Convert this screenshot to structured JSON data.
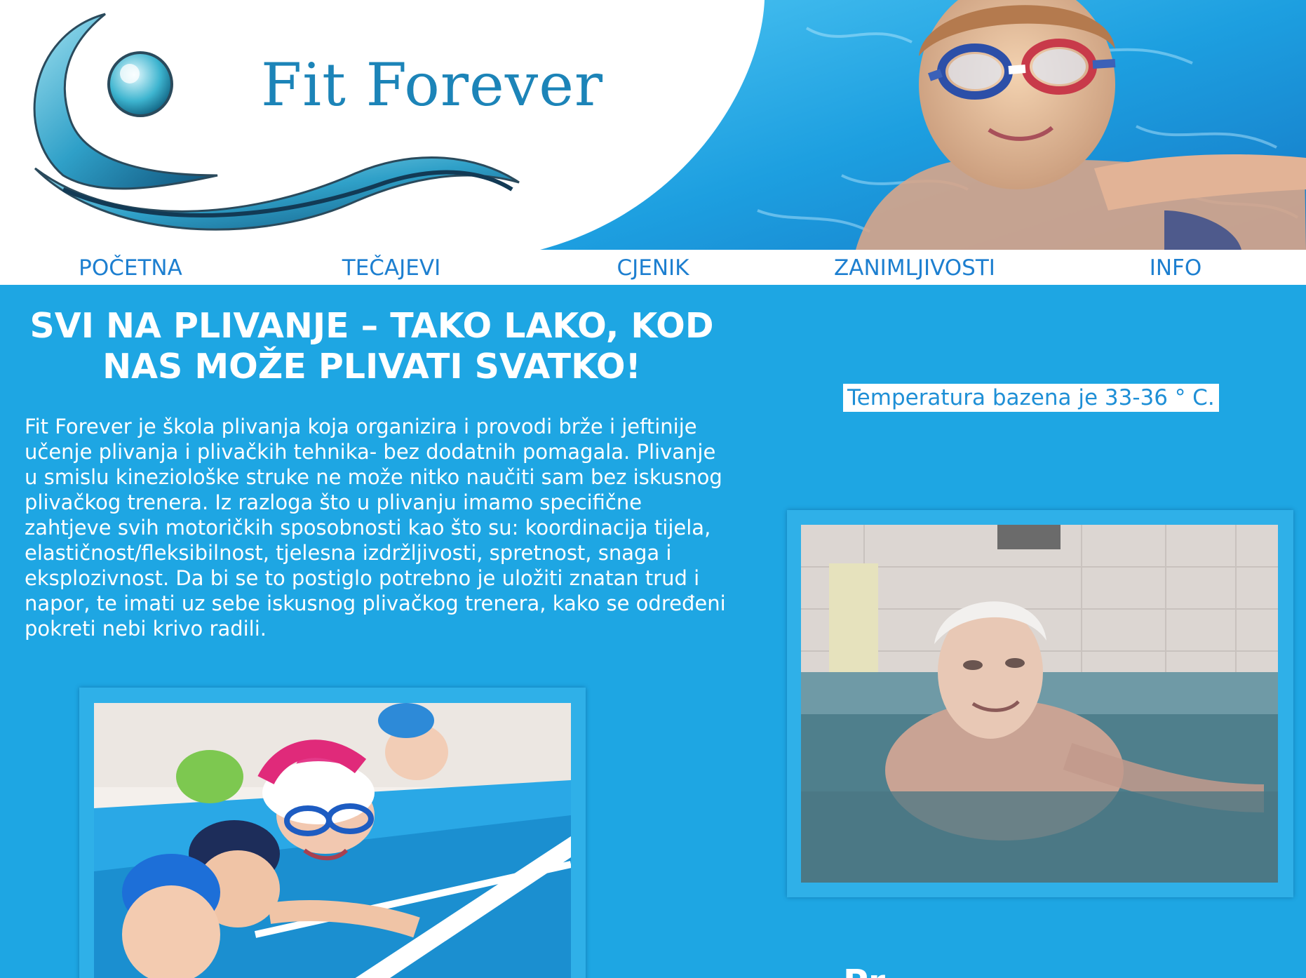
{
  "header": {
    "brand": "Fit Forever"
  },
  "nav": {
    "items": [
      {
        "label": "POČETNA"
      },
      {
        "label": "TEČAJEVI"
      },
      {
        "label": "CJENIK"
      },
      {
        "label": "ZANIMLJIVOSTI"
      },
      {
        "label": "INFO"
      }
    ]
  },
  "main": {
    "headline": "SVI NA PLIVANJE – TAKO LAKO, KOD NAS MOŽE PLIVATI SVATKO!",
    "intro": "Fit Forever je škola plivanja koja organizira i provodi brže i jeftinije učenje plivanja i plivačkih tehnika- bez dodatnih pomagala. Plivanje u smislu kineziološke struke ne može nitko naučiti sam bez iskusnog plivačkog trenera. Iz razloga što u plivanju imamo specifične zahtjeve svih motoričkih sposobnosti kao što su: koordinacija tijela, elastičnost/fleksibilnost, tjelesna izdržljivosti, spretnost, snaga i eksplozivnost. Da bi se to postiglo potrebno je uložiti znatan trud i napor, te imati uz sebe iskusnog plivačkog trenera, kako se određeni pokreti nebi krivo radili."
  },
  "sidebar": {
    "temperature_note": "Temperatura bazena je 33-36 ° C."
  },
  "colors": {
    "page_background": "#1ea6e3",
    "nav_text": "#1d7fd0",
    "brand_text": "#1c84b8",
    "pool_water": "#2aa8e6"
  }
}
